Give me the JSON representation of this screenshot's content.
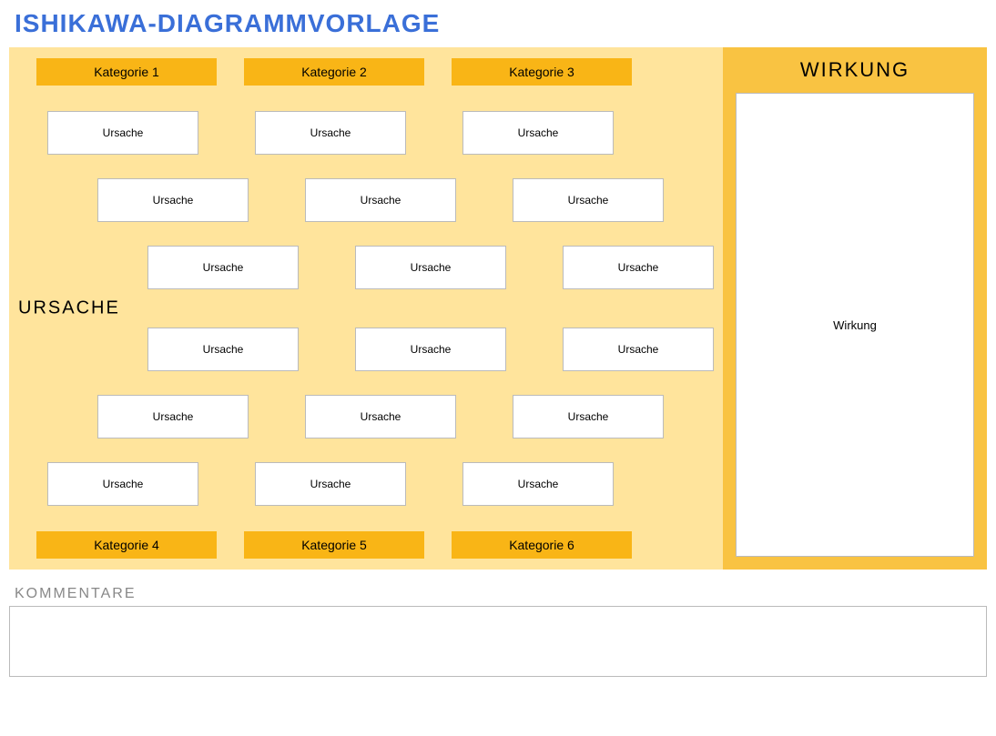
{
  "title": "ISHIKAWA-DIAGRAMMVORLAGE",
  "causeLabel": "URSACHE",
  "effectTitle": "WIRKUNG",
  "effectText": "Wirkung",
  "categoriesTop": [
    "Kategorie 1",
    "Kategorie 2",
    "Kategorie 3"
  ],
  "categoriesBottom": [
    "Kategorie 4",
    "Kategorie 5",
    "Kategorie 6"
  ],
  "causes": {
    "r1": [
      "Ursache",
      "Ursache",
      "Ursache"
    ],
    "r2": [
      "Ursache",
      "Ursache",
      "Ursache"
    ],
    "r3": [
      "Ursache",
      "Ursache",
      "Ursache"
    ],
    "r4": [
      "Ursache",
      "Ursache",
      "Ursache"
    ],
    "r5": [
      "Ursache",
      "Ursache",
      "Ursache"
    ],
    "r6": [
      "Ursache",
      "Ursache",
      "Ursache"
    ]
  },
  "commentsLabel": "KOMMENTARE",
  "commentsText": ""
}
